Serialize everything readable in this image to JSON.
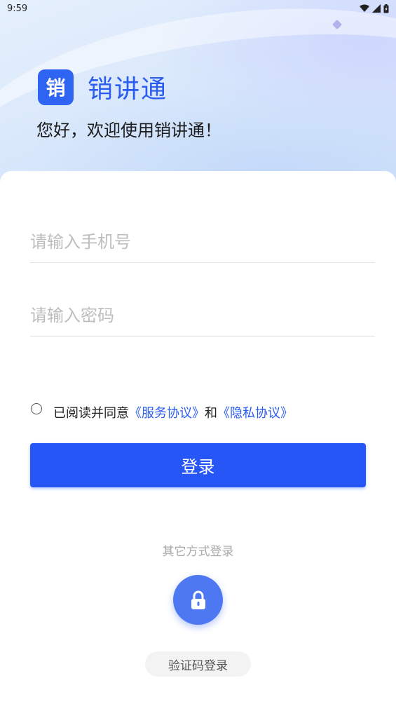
{
  "status_bar": {
    "time": "9:59"
  },
  "brand": {
    "logo_char": "销",
    "app_name": "销讲通",
    "welcome": "您好，欢迎使用销讲通！"
  },
  "form": {
    "phone_placeholder": "请输入手机号",
    "password_placeholder": "请输入密码",
    "agree_prefix": "已阅读并同意",
    "service_link": "《服务协议》",
    "and_text": "和",
    "privacy_link": "《隐私协议》",
    "login_label": "登录"
  },
  "alt_login": {
    "label": "其它方式登录",
    "sms_label": "验证码登录"
  },
  "colors": {
    "accent": "#2656f5",
    "brand_text": "#2a5cf0",
    "lock_button": "#4d78f2"
  },
  "icons": {
    "lock": "lock-icon",
    "wifi": "wifi-icon",
    "signal": "signal-icon",
    "battery": "battery-icon"
  }
}
